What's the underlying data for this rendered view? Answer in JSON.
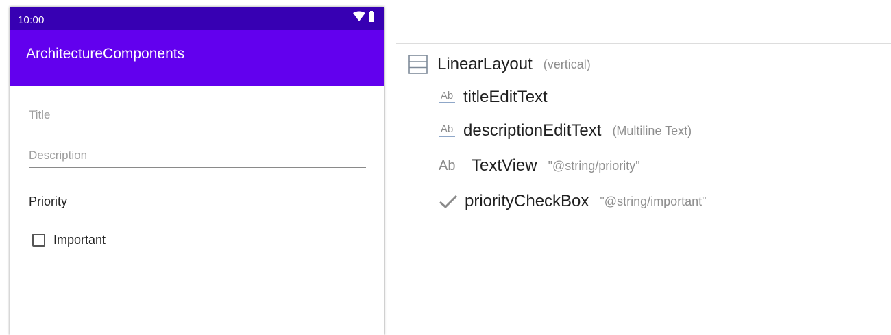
{
  "phone": {
    "status_time": "10:00",
    "app_title": "ArchitectureComponents",
    "title_placeholder": "Title",
    "description_placeholder": "Description",
    "priority_label": "Priority",
    "checkbox_label": "Important",
    "checkbox_checked": false
  },
  "colors": {
    "status_bar": "#3700b3",
    "app_bar": "#6200ee"
  },
  "tree": {
    "root": {
      "name": "LinearLayout",
      "meta": "(vertical)",
      "icon": "linear-layout-icon"
    },
    "children": [
      {
        "name": "titleEditText",
        "meta": "",
        "icon": "edit-text-icon"
      },
      {
        "name": "descriptionEditText",
        "meta": "(Multiline Text)",
        "icon": "edit-text-icon"
      },
      {
        "name": "TextView",
        "meta": "\"@string/priority\"",
        "icon": "text-view-icon",
        "icon_text": "Ab"
      },
      {
        "name": "priorityCheckBox",
        "meta": "\"@string/important\"",
        "icon": "checkbox-icon"
      }
    ]
  }
}
